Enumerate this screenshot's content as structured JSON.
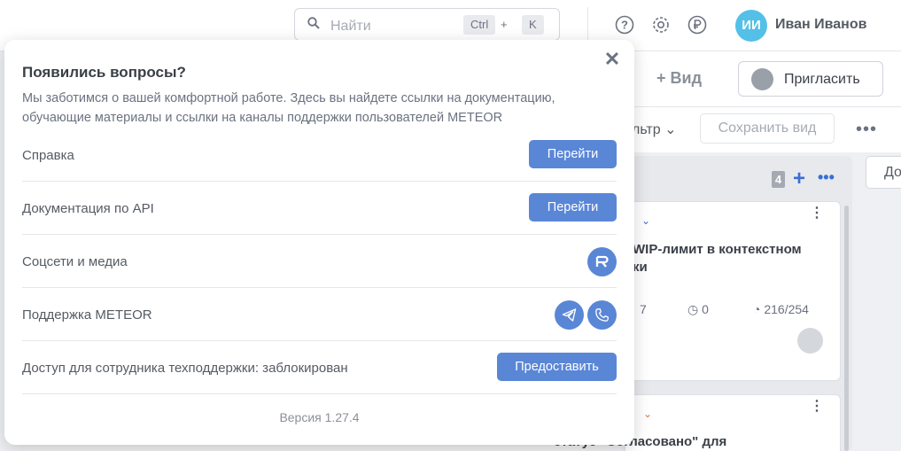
{
  "header": {
    "search_placeholder": "Найти",
    "shortcut_ctrl": "Ctrl",
    "shortcut_plus": "+",
    "shortcut_key": "K",
    "icons": [
      "help-icon",
      "settings-icon",
      "billing-ruble-icon"
    ],
    "user_initials": "ИИ",
    "user_name": "Иван Иванов"
  },
  "toolbar": {
    "add_view_label": "+ Вид",
    "invite_label": "Пригласить",
    "filter_label": "льтр ⌄",
    "save_view_label": "Сохранить вид",
    "more_label": "•••"
  },
  "board": {
    "column_count": "4",
    "add_label": "+",
    "column_menu": "•••",
    "right_button_label": "До",
    "card1": {
      "title": "WIP-лимит в контекстном\nки",
      "meta_a": "7",
      "meta_b": "0",
      "meta_c": "216/254"
    },
    "card2": {
      "title": "статус \"Согласовано\" для"
    }
  },
  "popover": {
    "title": "Появились вопросы?",
    "description": "Мы заботимся о вашей комфортной работе. Здесь вы найдете ссылки на документацию, обучающие материалы и ссылки на каналы поддержки пользователей METEOR",
    "rows": [
      {
        "label": "Справка",
        "button": "Перейти"
      },
      {
        "label": "Документация по API",
        "button": "Перейти"
      },
      {
        "label": "Соцсети и медиа"
      },
      {
        "label": "Поддержка METEOR"
      },
      {
        "label": "Доступ для сотрудника техподдержки: заблокирован",
        "button": "Предоставить"
      }
    ],
    "version": "Версия 1.27.4"
  },
  "colors": {
    "accent": "#5a86d6",
    "avatar": "#54c0e8"
  }
}
